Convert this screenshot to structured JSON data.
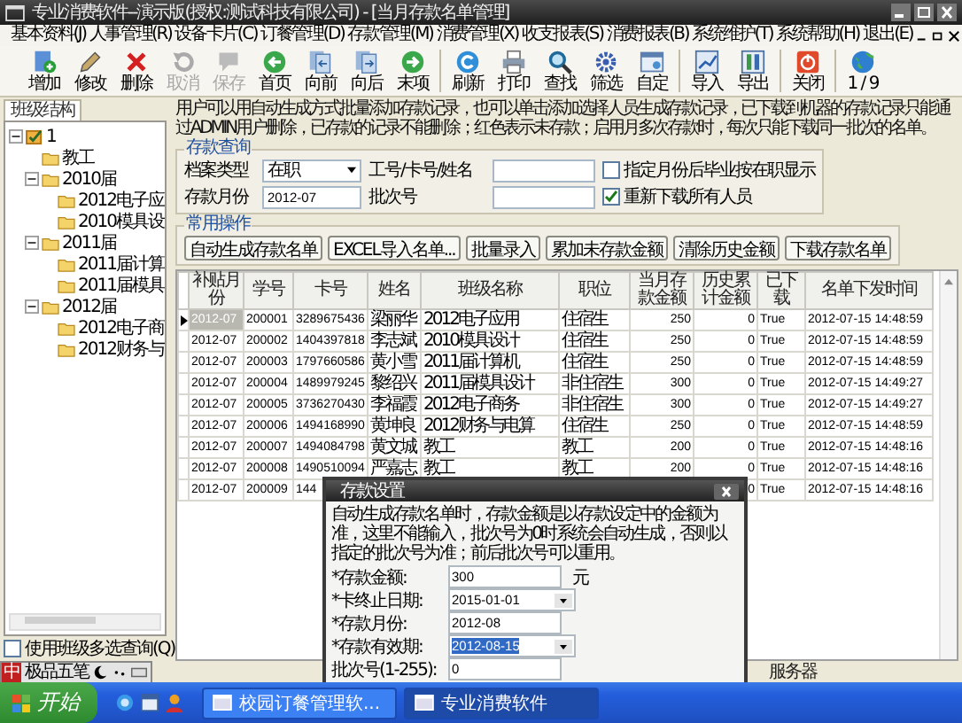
{
  "window": {
    "title": "专业消费软件--演示版(授权:测试科技有限公司) - [当月存款名单管理]"
  },
  "menu": [
    "基本资料(J)",
    "人事管理(R)",
    "设备卡片(C)",
    "订餐管理(D)",
    "存款管理(M)",
    "消费管理(X)",
    "收支报表(S)",
    "消费报表(B)",
    "系统维护(T)",
    "系统帮助(H)",
    "退出(E)"
  ],
  "toolbar": [
    {
      "label": "增加",
      "disabled": false
    },
    {
      "label": "修改",
      "disabled": false
    },
    {
      "label": "删除",
      "disabled": false
    },
    {
      "label": "取消",
      "disabled": true
    },
    {
      "label": "保存",
      "disabled": true
    },
    {
      "label": "首页",
      "disabled": false
    },
    {
      "label": "向前",
      "disabled": false
    },
    {
      "label": "向后",
      "disabled": false
    },
    {
      "label": "末项",
      "disabled": false
    },
    {
      "label": "刷新",
      "disabled": false
    },
    {
      "label": "打印",
      "disabled": false
    },
    {
      "label": "查找",
      "disabled": false
    },
    {
      "label": "筛选",
      "disabled": false
    },
    {
      "label": "自定",
      "disabled": false
    },
    {
      "label": "导入",
      "disabled": false
    },
    {
      "label": "导出",
      "disabled": false
    },
    {
      "label": "关闭",
      "disabled": false
    },
    {
      "label": "1 / 9",
      "disabled": false
    }
  ],
  "tree": {
    "tab": "班级结构",
    "items": [
      {
        "label": "1",
        "expanded": true,
        "children": [
          {
            "label": "教工"
          },
          {
            "label": "2010届",
            "expanded": true,
            "children": [
              {
                "label": "2012电子应"
              },
              {
                "label": "2010模具设"
              }
            ]
          },
          {
            "label": "2011届",
            "expanded": true,
            "children": [
              {
                "label": "2011届计算"
              },
              {
                "label": "2011届模具"
              }
            ]
          },
          {
            "label": "2012届",
            "expanded": true,
            "children": [
              {
                "label": "2012电子商"
              },
              {
                "label": "2012财务与"
              }
            ]
          }
        ]
      }
    ]
  },
  "multi_select": {
    "label": "使用班级多选查询(Q)",
    "checked": false
  },
  "info": "用户可以用自动生成方式批量添加存款记录，也可以单击添加选择人员生成存款记录，已下载到机器的存款记录只能通过ADMIN用户删除，已存款的记录不能删除；红色表示未存款；启用月多次存款时，每次只能下载同一批次的名单。",
  "query": {
    "legend": "存款查询",
    "archive_type": {
      "label": "档案类型",
      "value": "在职"
    },
    "search": {
      "label": "工号/卡号/姓名"
    },
    "month": {
      "label": "存款月份",
      "value": "2012-07"
    },
    "batch": {
      "label": "批次号"
    },
    "options": [
      {
        "label": "指定月份后毕业按在职显示",
        "checked": false
      },
      {
        "label": "重新下载所有人员",
        "checked": true
      }
    ]
  },
  "operations": {
    "legend": "常用操作",
    "buttons": [
      "自动生成存款名单",
      "EXCEL导入名单...",
      "批量录入",
      "累加未存款金额",
      "清除历史金额",
      "下载存款名单"
    ]
  },
  "table": {
    "columns": [
      "补贴月份",
      "学号",
      "卡号",
      "姓名",
      "班级名称",
      "职位",
      "当月存款金额",
      "历史累计金额",
      "已下载",
      "名单下发时间"
    ],
    "rows": [
      {
        "selected": true,
        "cells": [
          "2012-07",
          "200001",
          "3289675436",
          "梁丽华",
          "2012电子应用",
          "住宿生",
          "250",
          "0",
          "True",
          "2012-07-15 14:48:59"
        ]
      },
      {
        "selected": false,
        "cells": [
          "2012-07",
          "200002",
          "1404397818",
          "李志斌",
          "2010模具设计",
          "住宿生",
          "250",
          "0",
          "True",
          "2012-07-15 14:48:59"
        ]
      },
      {
        "selected": false,
        "cells": [
          "2012-07",
          "200003",
          "1797660586",
          "黄小雪",
          "2011届计算机",
          "住宿生",
          "250",
          "0",
          "True",
          "2012-07-15 14:48:59"
        ]
      },
      {
        "selected": false,
        "cells": [
          "2012-07",
          "200004",
          "1489979245",
          "黎绍兴",
          "2011届模具设计",
          "非住宿生",
          "300",
          "0",
          "True",
          "2012-07-15 14:49:27"
        ]
      },
      {
        "selected": false,
        "cells": [
          "2012-07",
          "200005",
          "3736270430",
          "李福霞",
          "2012电子商务",
          "非住宿生",
          "300",
          "0",
          "True",
          "2012-07-15 14:49:27"
        ]
      },
      {
        "selected": false,
        "cells": [
          "2012-07",
          "200006",
          "1494168990",
          "黄坤良",
          "2012财务与电算",
          "住宿生",
          "250",
          "0",
          "True",
          "2012-07-15 14:48:59"
        ]
      },
      {
        "selected": false,
        "cells": [
          "2012-07",
          "200007",
          "1494084798",
          "黄文城",
          "教工",
          "教工",
          "200",
          "0",
          "True",
          "2012-07-15 14:48:16"
        ]
      },
      {
        "selected": false,
        "cells": [
          "2012-07",
          "200008",
          "1490510094",
          "严嘉志",
          "教工",
          "教工",
          "200",
          "0",
          "True",
          "2012-07-15 14:48:16"
        ]
      },
      {
        "selected": false,
        "cells": [
          "2012-07",
          "200009",
          "144",
          null,
          null,
          null,
          null,
          "0",
          "True",
          "2012-07-15 14:48:16"
        ]
      }
    ]
  },
  "dialog": {
    "title": "存款设置",
    "note": "自动生成存款名单时，存款金额是以存款设定中的金额为准，这里不能输入，批次号为0时系统会自动生成，否则以指定的批次号为准；前后批次号可以重用。",
    "fields": [
      {
        "kind": "text",
        "label": "*存款金额:",
        "value": "300",
        "unit": "元",
        "highlighted": false
      },
      {
        "kind": "dropdown",
        "label": "*卡终止日期:",
        "value": "2015-01-01",
        "highlighted": false
      },
      {
        "kind": "text",
        "label": "*存款月份:",
        "value": "2012-08",
        "highlighted": false
      },
      {
        "kind": "dropdown",
        "label": "*存款有效期:",
        "value": "2012-08-15",
        "highlighted": true
      },
      {
        "kind": "text",
        "label": "批次号(1-255):",
        "value": "0",
        "highlighted": false
      }
    ]
  },
  "ime": {
    "mode": "中",
    "name": "极品五笔"
  },
  "status_bar": {
    "text": "服务器"
  },
  "taskbar": {
    "start": "开始",
    "tasks": [
      {
        "label": "校园订餐管理软...",
        "selected": false
      },
      {
        "label": "专业消费软件",
        "selected": true
      }
    ]
  }
}
